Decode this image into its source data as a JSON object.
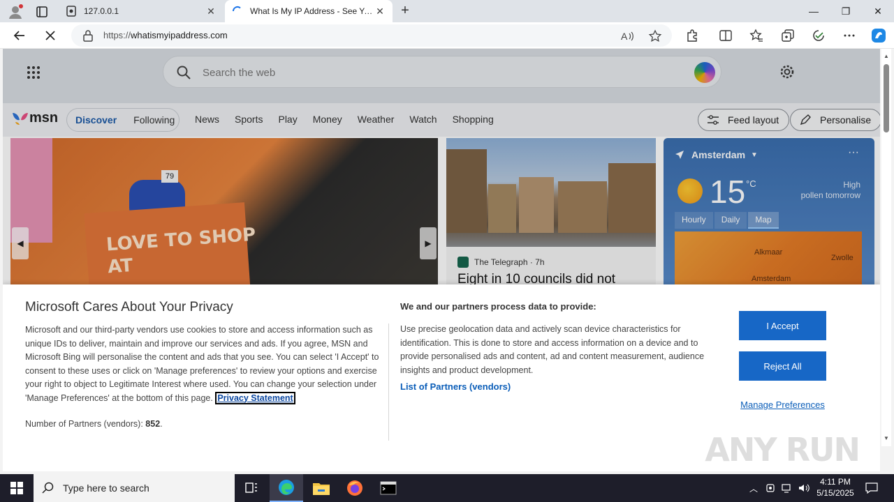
{
  "browser": {
    "tabs": [
      {
        "title": "127.0.0.1"
      },
      {
        "title": "What Is My IP Address - See Your"
      }
    ],
    "url_scheme": "https://",
    "url_host": "whatismyipaddress.com"
  },
  "msn": {
    "search_placeholder": "Search the web",
    "logo_text": "msn",
    "pills": [
      "Discover",
      "Following"
    ],
    "links": [
      "News",
      "Sports",
      "Play",
      "Money",
      "Weather",
      "Watch",
      "Shopping"
    ],
    "feed_layout": "Feed layout",
    "personalise": "Personalise",
    "card": {
      "source": "The Telegraph",
      "age": "· 7h",
      "headline": "Eight in 10 councils did not"
    },
    "hero_text_line1": "LOVE TO SHOP",
    "hero_text_line2": "AT",
    "hero_tag": "79",
    "weather": {
      "location": "Amsterdam",
      "temp": "15",
      "unit": "°C",
      "pollen_line1": "High",
      "pollen_line2": "pollen tomorrow",
      "tabs": [
        "Hourly",
        "Daily",
        "Map"
      ],
      "map_cities": [
        "Alkmaar",
        "Zwolle",
        "Amsterdam"
      ]
    }
  },
  "privacy": {
    "title": "Microsoft Cares About Your Privacy",
    "body": "Microsoft and our third-party vendors use cookies to store and access information such as unique IDs to deliver, maintain and improve our services and ads. If you agree, MSN and Microsoft Bing will personalise the content and ads that you see. You can select 'I Accept' to consent to these uses or click on 'Manage preferences' to review your options and exercise your right to object to Legitimate Interest where used.  You can change your selection under 'Manage Preferences' at the bottom of this page.",
    "privacy_link": "Privacy Statement",
    "partners_label": "Number of Partners (vendors): ",
    "partners_count": "852",
    "partners_suffix": ".",
    "h2": "We and our partners process data to provide:",
    "body2": "Use precise geolocation data and actively scan device characteristics for identification. This is done to store and access information on a device and to provide personalised ads and content, ad and content measurement, audience insights and product development.",
    "vendors_link": "List of Partners (vendors)",
    "accept": "I Accept",
    "reject": "Reject All",
    "manage": "Manage Preferences"
  },
  "watermark": "ANY RUN",
  "taskbar": {
    "search_placeholder": "Type here to search",
    "time": "4:11 PM",
    "date": "5/15/2025"
  },
  "colors": {
    "accent": "#1767c6",
    "link": "#0a5db8",
    "taskbar": "#1e1e2a"
  }
}
